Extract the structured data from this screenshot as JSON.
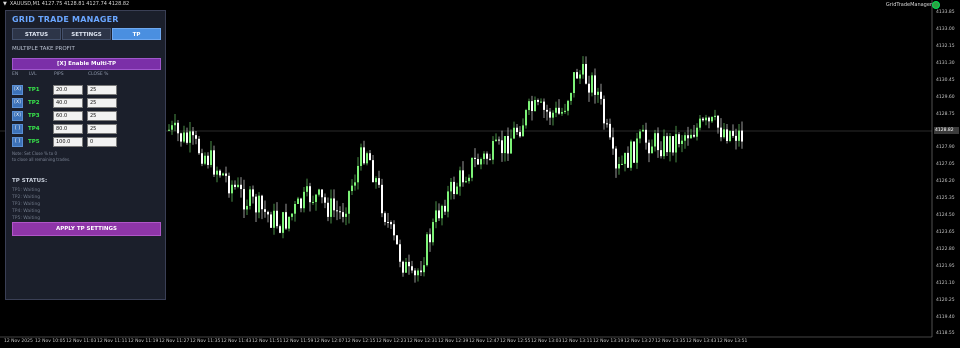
{
  "symbol_line": "XAUUSD,M1  4127.75 4128.81 4127.74 4128.82",
  "ea_name": "GridTradeManager",
  "panel": {
    "title": "GRID TRADE MANAGER",
    "tabs": [
      "STATUS",
      "SETTINGS",
      "TP"
    ],
    "active_tab": "TP",
    "section_title": "MULTIPLE TAKE PROFIT",
    "enable_button": "[X] Enable Multi-TP",
    "col_headers": [
      "EN",
      "LVL",
      "PIPS",
      "CLOSE %"
    ],
    "tp_rows": [
      {
        "toggle": "[X]",
        "label": "TP1",
        "price": "20.0",
        "close": "25"
      },
      {
        "toggle": "[X]",
        "label": "TP2",
        "price": "40.0",
        "close": "25"
      },
      {
        "toggle": "[X]",
        "label": "TP3",
        "price": "60.0",
        "close": "25"
      },
      {
        "toggle": "[ ]",
        "label": "TP4",
        "price": "80.0",
        "close": "25"
      },
      {
        "toggle": "[ ]",
        "label": "TP5",
        "price": "100.0",
        "close": "0"
      }
    ],
    "note_lines": [
      "Note: Set Close % to 0",
      "to close all remaining trades."
    ],
    "status_title": "TP STATUS:",
    "status_lines": [
      "TP1: Waiting",
      "TP2: Waiting",
      "TP3: Waiting",
      "TP4: Waiting",
      "TP5: Waiting"
    ],
    "apply_button": "APPLY TP SETTINGS"
  },
  "price_scale": [
    "4133.85",
    "4133.00",
    "4132.15",
    "4131.30",
    "4130.45",
    "4129.60",
    "4128.75",
    "4127.90",
    "4127.05",
    "4126.20",
    "4125.35",
    "4124.50",
    "4123.65",
    "4122.80",
    "4121.95",
    "4121.10",
    "4120.25",
    "4119.40",
    "4118.55",
    "4117.70"
  ],
  "current_price": "4128.82",
  "time_axis": [
    "12 Nov 2025",
    "12 Nov 10:05",
    "12 Nov 11:03",
    "12 Nov 11:11",
    "12 Nov 11:19",
    "12 Nov 11:27",
    "12 Nov 11:35",
    "12 Nov 11:43",
    "12 Nov 11:51",
    "12 Nov 11:59",
    "12 Nov 12:07",
    "12 Nov 12:15",
    "12 Nov 12:23",
    "12 Nov 12:31",
    "12 Nov 12:39",
    "12 Nov 12:47",
    "12 Nov 12:55",
    "12 Nov 13:03",
    "12 Nov 13:11",
    "12 Nov 13:19",
    "12 Nov 13:27",
    "12 Nov 13:35",
    "12 Nov 13:43",
    "12 Nov 13:51"
  ],
  "colors": {
    "bull": "#7cf277",
    "bear": "#ffffff",
    "panel_bg": "#1b1f2b",
    "accent": "#4a8fe0",
    "purple": "#8e35a8"
  }
}
